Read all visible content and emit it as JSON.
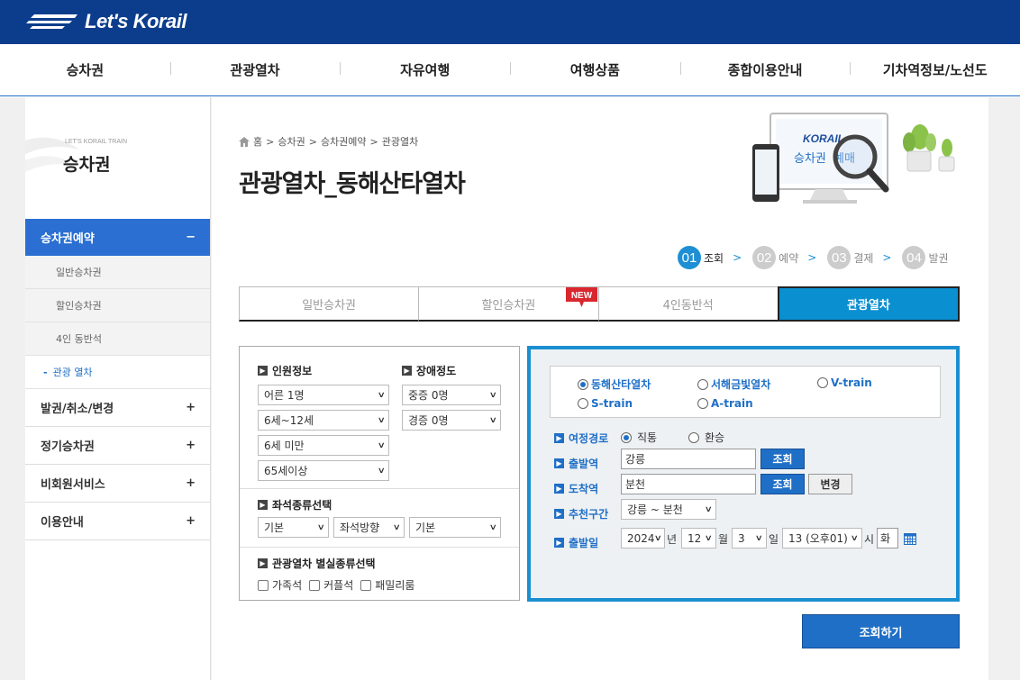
{
  "brand": {
    "name": "Let's Korail"
  },
  "gnb": [
    "승차권",
    "관광열차",
    "자유여행",
    "여행상품",
    "종합이용안내",
    "기차역정보/노선도"
  ],
  "lnb": {
    "small_caption": "LET'S KORAIL TRAIN",
    "title": "승차권",
    "active": {
      "label": "승차권예약",
      "toggle": "−"
    },
    "subs": [
      "일반승차권",
      "할인승차권",
      "4인 동반석"
    ],
    "current_sub": {
      "marker": "-",
      "label": "관광 열차"
    },
    "mains": [
      {
        "label": "발권/취소/변경",
        "toggle": "+"
      },
      {
        "label": "정기승차권",
        "toggle": "+"
      },
      {
        "label": "비회원서비스",
        "toggle": "+"
      },
      {
        "label": "이용안내",
        "toggle": "+"
      }
    ]
  },
  "breadcrumb": [
    "홈",
    "승차권",
    "승차권예약",
    "관광열차"
  ],
  "page_title": "관광열차_동해산타열차",
  "hero": {
    "brand": "KORAIL",
    "caption1": "승차권",
    "caption2": "예매"
  },
  "steps": [
    {
      "num": "01",
      "label": "조회",
      "active": true
    },
    {
      "num": "02",
      "label": "예약",
      "active": false
    },
    {
      "num": "03",
      "label": "결제",
      "active": false
    },
    {
      "num": "04",
      "label": "발권",
      "active": false
    }
  ],
  "tabs": [
    {
      "label": "일반승차권",
      "active": false
    },
    {
      "label": "할인승차권",
      "active": false,
      "badge": "NEW"
    },
    {
      "label": "4인동반석",
      "active": false
    },
    {
      "label": "관광열차",
      "active": true
    }
  ],
  "passengers": {
    "heading": "인원정보",
    "adult": "어른 1명",
    "child": "6세~12세",
    "infant": "6세 미만",
    "senior": "65세이상"
  },
  "disability": {
    "heading": "장애정도",
    "severe": "중증 0명",
    "mild": "경증 0명"
  },
  "seat": {
    "heading": "좌석종류선택",
    "type": "기본",
    "direction": "좌석방향",
    "position": "기본"
  },
  "room": {
    "heading": "관광열차 별실종류선택",
    "options": [
      "가족석",
      "커플석",
      "패밀리룸"
    ]
  },
  "trains": [
    {
      "label": "동해산타열차",
      "selected": true
    },
    {
      "label": "서해금빛열차",
      "selected": false
    },
    {
      "label": "V-train",
      "selected": false
    },
    {
      "label": "S-train",
      "selected": false
    },
    {
      "label": "A-train",
      "selected": false
    }
  ],
  "form": {
    "route_label": "여정경로",
    "route_direct": "직통",
    "route_transfer": "환승",
    "dep_label": "출발역",
    "dep_value": "강릉",
    "arr_label": "도착역",
    "arr_value": "분천",
    "lookup": "조회",
    "swap": "변경",
    "rec_label": "추천구간",
    "rec_value": "강릉 ~ 분천",
    "date_label": "출발일",
    "year": "2024",
    "year_unit": "년",
    "month": "12",
    "month_unit": "월",
    "day": "3",
    "day_unit": "일",
    "hour": "13 (오후01)",
    "hour_unit": "시",
    "weekday": "화"
  },
  "search_button": "조회하기",
  "colors": {
    "topbar": "#0c3d8c",
    "accent": "#1f6fc6",
    "tab_active": "#0a8fd1",
    "badge": "#d9272e"
  }
}
